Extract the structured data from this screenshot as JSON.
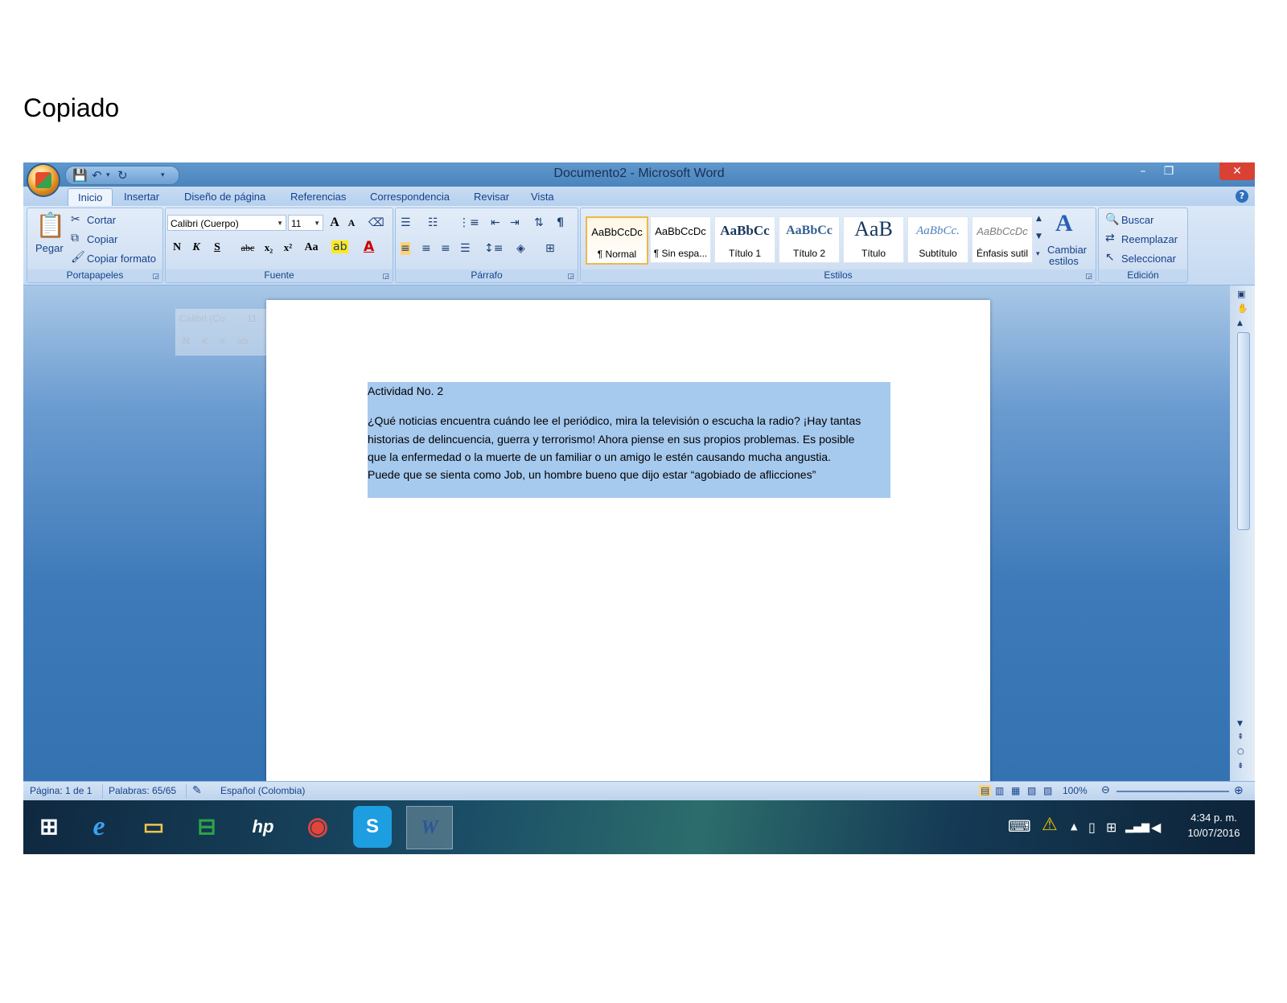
{
  "heading": "Copiado",
  "window": {
    "title": "Documento2 - Microsoft Word",
    "minimize": "–",
    "restore": "❐",
    "close": "✕"
  },
  "tabs": [
    "Inicio",
    "Insertar",
    "Diseño de página",
    "Referencias",
    "Correspondencia",
    "Revisar",
    "Vista"
  ],
  "clipboard": {
    "paste": "Pegar",
    "cut": "Cortar",
    "copy": "Copiar",
    "format_painter": "Copiar formato",
    "group_label": "Portapapeles"
  },
  "font": {
    "family": "Calibri (Cuerpo)",
    "size": "11",
    "group_label": "Fuente",
    "bold": "N",
    "italic": "K",
    "underline": "S",
    "strike": "abc",
    "subscript": "x₂",
    "superscript": "x²",
    "change_case": "Aa",
    "grow": "A",
    "shrink": "A"
  },
  "paragraph": {
    "group_label": "Párrafo"
  },
  "styles": {
    "group_label": "Estilos",
    "items": [
      {
        "preview": "AaBbCcDc",
        "name": "¶ Normal"
      },
      {
        "preview": "AaBbCcDc",
        "name": "¶ Sin espa..."
      },
      {
        "preview": "AaBbCc",
        "name": "Título 1"
      },
      {
        "preview": "AaBbCc",
        "name": "Título 2"
      },
      {
        "preview": "AaB",
        "name": "Título"
      },
      {
        "preview": "AaBbCc.",
        "name": "Subtítulo"
      },
      {
        "preview": "AaBbCcDc",
        "name": "Énfasis sutil"
      }
    ],
    "change_styles": "Cambiar",
    "change_styles_2": "estilos"
  },
  "editing": {
    "find": "Buscar",
    "replace": "Reemplazar",
    "select": "Seleccionar",
    "group_label": "Edición"
  },
  "mini_toolbar": {
    "font": "Calibri (Cu",
    "size": "11"
  },
  "document": {
    "title": "Actividad No. 2",
    "lines": [
      "¿Qué noticias encuentra cuándo lee el periódico, mira la televisión o escucha la radio? ¡Hay tantas",
      "historias de delincuencia, guerra y terrorismo! Ahora piense en sus propios problemas. Es posible",
      "que la enfermedad o la muerte de un familiar o  un amigo le estén causando mucha angustia.",
      "Puede que se sienta como Job, un hombre bueno que dijo estar “agobiado de aflicciones”"
    ]
  },
  "status": {
    "page": "Página: 1 de 1",
    "words": "Palabras: 65/65",
    "language": "Español (Colombia)",
    "zoom": "100%"
  },
  "taskbar": {
    "time": "4:34 p. m.",
    "date": "10/07/2016"
  }
}
